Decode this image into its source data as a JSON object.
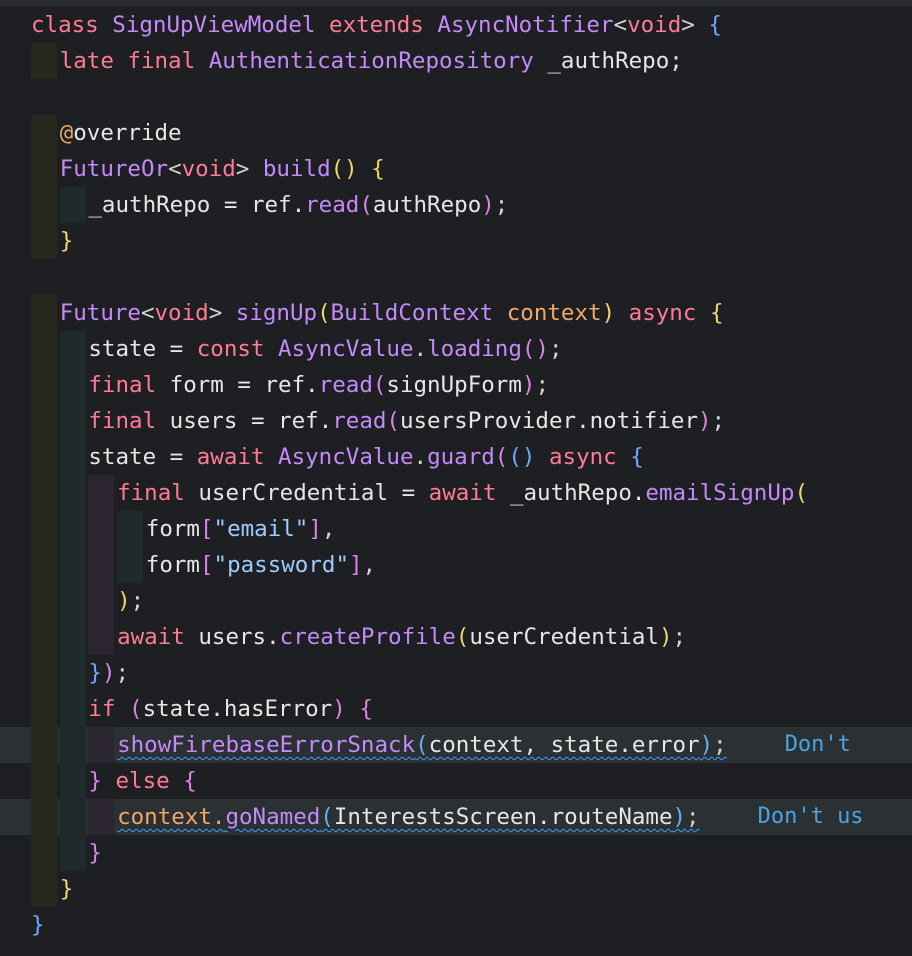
{
  "lines": [
    {
      "indent": 0,
      "tokens": [
        {
          "t": "class ",
          "c": "kw"
        },
        {
          "t": "SignUpViewModel ",
          "c": "cls"
        },
        {
          "t": "extends ",
          "c": "kw"
        },
        {
          "t": "AsyncNotifier",
          "c": "cls"
        },
        {
          "t": "<",
          "c": "punct"
        },
        {
          "t": "void",
          "c": "kw"
        },
        {
          "t": "> ",
          "c": "punct"
        },
        {
          "t": "{",
          "c": "p3"
        }
      ]
    },
    {
      "indent": 1,
      "tokens": [
        {
          "t": "late ",
          "c": "kw"
        },
        {
          "t": "final ",
          "c": "kw"
        },
        {
          "t": "AuthenticationRepository ",
          "c": "cls"
        },
        {
          "t": "_authRepo;",
          "c": "var"
        }
      ]
    },
    {
      "indent": 0,
      "tokens": []
    },
    {
      "indent": 1,
      "tokens": [
        {
          "t": "@",
          "c": "meta"
        },
        {
          "t": "override",
          "c": "var"
        }
      ]
    },
    {
      "indent": 1,
      "tokens": [
        {
          "t": "FutureOr",
          "c": "cls"
        },
        {
          "t": "<",
          "c": "punct"
        },
        {
          "t": "void",
          "c": "kw"
        },
        {
          "t": "> ",
          "c": "punct"
        },
        {
          "t": "build",
          "c": "fn"
        },
        {
          "t": "() ",
          "c": "p1"
        },
        {
          "t": "{",
          "c": "p1"
        }
      ]
    },
    {
      "indent": 2,
      "tokens": [
        {
          "t": "_authRepo = ",
          "c": "var"
        },
        {
          "t": "ref.",
          "c": "var"
        },
        {
          "t": "read",
          "c": "fn"
        },
        {
          "t": "(",
          "c": "p2"
        },
        {
          "t": "authRepo",
          "c": "var"
        },
        {
          "t": ")",
          "c": "p2"
        },
        {
          "t": ";",
          "c": "punct"
        }
      ]
    },
    {
      "indent": 1,
      "tokens": [
        {
          "t": "}",
          "c": "p1"
        }
      ]
    },
    {
      "indent": 0,
      "tokens": []
    },
    {
      "indent": 1,
      "tokens": [
        {
          "t": "Future",
          "c": "cls"
        },
        {
          "t": "<",
          "c": "punct"
        },
        {
          "t": "void",
          "c": "kw"
        },
        {
          "t": "> ",
          "c": "punct"
        },
        {
          "t": "signUp",
          "c": "fn"
        },
        {
          "t": "(",
          "c": "p1"
        },
        {
          "t": "BuildContext ",
          "c": "cls"
        },
        {
          "t": "context",
          "c": "param"
        },
        {
          "t": ") ",
          "c": "p1"
        },
        {
          "t": "async ",
          "c": "kw"
        },
        {
          "t": "{",
          "c": "p1"
        }
      ]
    },
    {
      "indent": 2,
      "tokens": [
        {
          "t": "state = ",
          "c": "var"
        },
        {
          "t": "const ",
          "c": "kw"
        },
        {
          "t": "AsyncValue",
          "c": "cls"
        },
        {
          "t": ".",
          "c": "punct"
        },
        {
          "t": "loading",
          "c": "fn"
        },
        {
          "t": "()",
          "c": "p2"
        },
        {
          "t": ";",
          "c": "punct"
        }
      ]
    },
    {
      "indent": 2,
      "tokens": [
        {
          "t": "final ",
          "c": "kw"
        },
        {
          "t": "form = ",
          "c": "var"
        },
        {
          "t": "ref.",
          "c": "var"
        },
        {
          "t": "read",
          "c": "fn"
        },
        {
          "t": "(",
          "c": "p2"
        },
        {
          "t": "signUpForm",
          "c": "var"
        },
        {
          "t": ")",
          "c": "p2"
        },
        {
          "t": ";",
          "c": "punct"
        }
      ]
    },
    {
      "indent": 2,
      "tokens": [
        {
          "t": "final ",
          "c": "kw"
        },
        {
          "t": "users = ",
          "c": "var"
        },
        {
          "t": "ref.",
          "c": "var"
        },
        {
          "t": "read",
          "c": "fn"
        },
        {
          "t": "(",
          "c": "p2"
        },
        {
          "t": "usersProvider.notifier",
          "c": "var"
        },
        {
          "t": ")",
          "c": "p2"
        },
        {
          "t": ";",
          "c": "punct"
        }
      ]
    },
    {
      "indent": 2,
      "tokens": [
        {
          "t": "state = ",
          "c": "var"
        },
        {
          "t": "await ",
          "c": "kw"
        },
        {
          "t": "AsyncValue",
          "c": "cls"
        },
        {
          "t": ".",
          "c": "punct"
        },
        {
          "t": "guard",
          "c": "fn"
        },
        {
          "t": "(",
          "c": "p2"
        },
        {
          "t": "() ",
          "c": "p3"
        },
        {
          "t": "async ",
          "c": "kw"
        },
        {
          "t": "{",
          "c": "p3"
        }
      ]
    },
    {
      "indent": 3,
      "tokens": [
        {
          "t": "final ",
          "c": "kw"
        },
        {
          "t": "userCredential = ",
          "c": "var"
        },
        {
          "t": "await ",
          "c": "kw"
        },
        {
          "t": "_authRepo.",
          "c": "var"
        },
        {
          "t": "emailSignUp",
          "c": "fn"
        },
        {
          "t": "(",
          "c": "p1"
        }
      ]
    },
    {
      "indent": 4,
      "tokens": [
        {
          "t": "form",
          "c": "var"
        },
        {
          "t": "[",
          "c": "p2"
        },
        {
          "t": "\"email\"",
          "c": "str"
        },
        {
          "t": "]",
          "c": "p2"
        },
        {
          "t": ",",
          "c": "punct"
        }
      ]
    },
    {
      "indent": 4,
      "tokens": [
        {
          "t": "form",
          "c": "var"
        },
        {
          "t": "[",
          "c": "p2"
        },
        {
          "t": "\"password\"",
          "c": "str"
        },
        {
          "t": "]",
          "c": "p2"
        },
        {
          "t": ",",
          "c": "punct"
        }
      ]
    },
    {
      "indent": 3,
      "tokens": [
        {
          "t": ")",
          "c": "p1"
        },
        {
          "t": ";",
          "c": "punct"
        }
      ]
    },
    {
      "indent": 3,
      "tokens": [
        {
          "t": "await ",
          "c": "kw"
        },
        {
          "t": "users.",
          "c": "var"
        },
        {
          "t": "createProfile",
          "c": "fn"
        },
        {
          "t": "(",
          "c": "p1"
        },
        {
          "t": "userCredential",
          "c": "var"
        },
        {
          "t": ")",
          "c": "p1"
        },
        {
          "t": ";",
          "c": "punct"
        }
      ]
    },
    {
      "indent": 2,
      "tokens": [
        {
          "t": "}",
          "c": "p3"
        },
        {
          "t": ")",
          "c": "p2"
        },
        {
          "t": ";",
          "c": "punct"
        }
      ]
    },
    {
      "indent": 2,
      "tokens": [
        {
          "t": "if ",
          "c": "kw"
        },
        {
          "t": "(",
          "c": "p2"
        },
        {
          "t": "state.hasError",
          "c": "var"
        },
        {
          "t": ") ",
          "c": "p2"
        },
        {
          "t": "{",
          "c": "p2"
        }
      ]
    },
    {
      "indent": 3,
      "highlight": true,
      "lint": true,
      "hint": "Don't",
      "tokens": [
        {
          "t": "showFirebaseErrorSnack",
          "c": "fn"
        },
        {
          "t": "(",
          "c": "p3"
        },
        {
          "t": "context, state.error",
          "c": "var"
        },
        {
          "t": ")",
          "c": "p3"
        },
        {
          "t": ";",
          "c": "punct"
        }
      ]
    },
    {
      "indent": 2,
      "tokens": [
        {
          "t": "} ",
          "c": "p2"
        },
        {
          "t": "else ",
          "c": "kw"
        },
        {
          "t": "{",
          "c": "p2"
        }
      ]
    },
    {
      "indent": 3,
      "highlight": true,
      "lint": true,
      "hint": "Don't us",
      "tokens": [
        {
          "t": "context.",
          "c": "param"
        },
        {
          "t": "goNamed",
          "c": "fn"
        },
        {
          "t": "(",
          "c": "p3"
        },
        {
          "t": "InterestsScreen.routeName",
          "c": "var"
        },
        {
          "t": ")",
          "c": "p3"
        },
        {
          "t": ";",
          "c": "punct"
        }
      ]
    },
    {
      "indent": 2,
      "tokens": [
        {
          "t": "}",
          "c": "p2"
        }
      ]
    },
    {
      "indent": 1,
      "tokens": [
        {
          "t": "}",
          "c": "p1"
        }
      ]
    },
    {
      "indent": 0,
      "tokens": [
        {
          "t": "}",
          "c": "p3"
        }
      ]
    }
  ]
}
